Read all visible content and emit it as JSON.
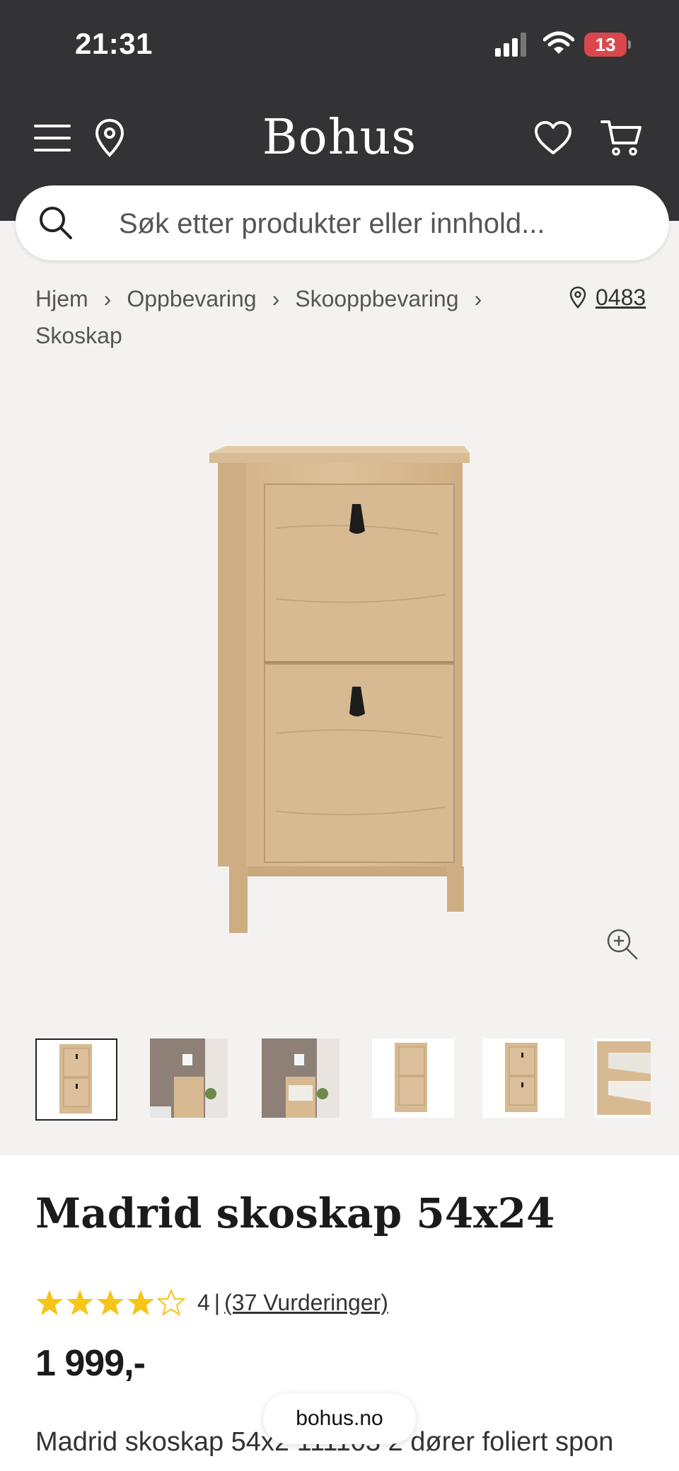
{
  "status_bar": {
    "time": "21:31",
    "battery": "13",
    "icons": [
      "cellular-signal-icon",
      "wifi-icon",
      "battery-icon"
    ]
  },
  "header": {
    "brand": "Bohus",
    "menu_icon": "hamburger-menu-icon",
    "location_icon": "location-pin-icon",
    "wishlist_icon": "heart-icon",
    "cart_icon": "shopping-cart-icon",
    "background": "#333335"
  },
  "search": {
    "placeholder": "Søk etter produkter eller innhold..."
  },
  "breadcrumb": {
    "items": [
      "Hjem",
      "Oppbevaring",
      "Skooppbevaring",
      "Skoskap"
    ]
  },
  "store": {
    "label": "0483"
  },
  "gallery": {
    "thumbnail_count": 6,
    "selected_index": 0
  },
  "product": {
    "title": "Madrid skoskap 54x24",
    "rating_value": "4",
    "rating_separator": "|",
    "rating_count": "(37 Vurderinger)",
    "stars_filled": 4,
    "stars_total": 5,
    "price": "1 999,-",
    "description": "Madrid skoskap 54x2 111103 2 dører foliert spon"
  },
  "browser": {
    "url": "bohus.no"
  },
  "colors": {
    "star": "#f5c518",
    "gallery_bg": "#f4f2f1",
    "wood": "#d8b98f"
  }
}
